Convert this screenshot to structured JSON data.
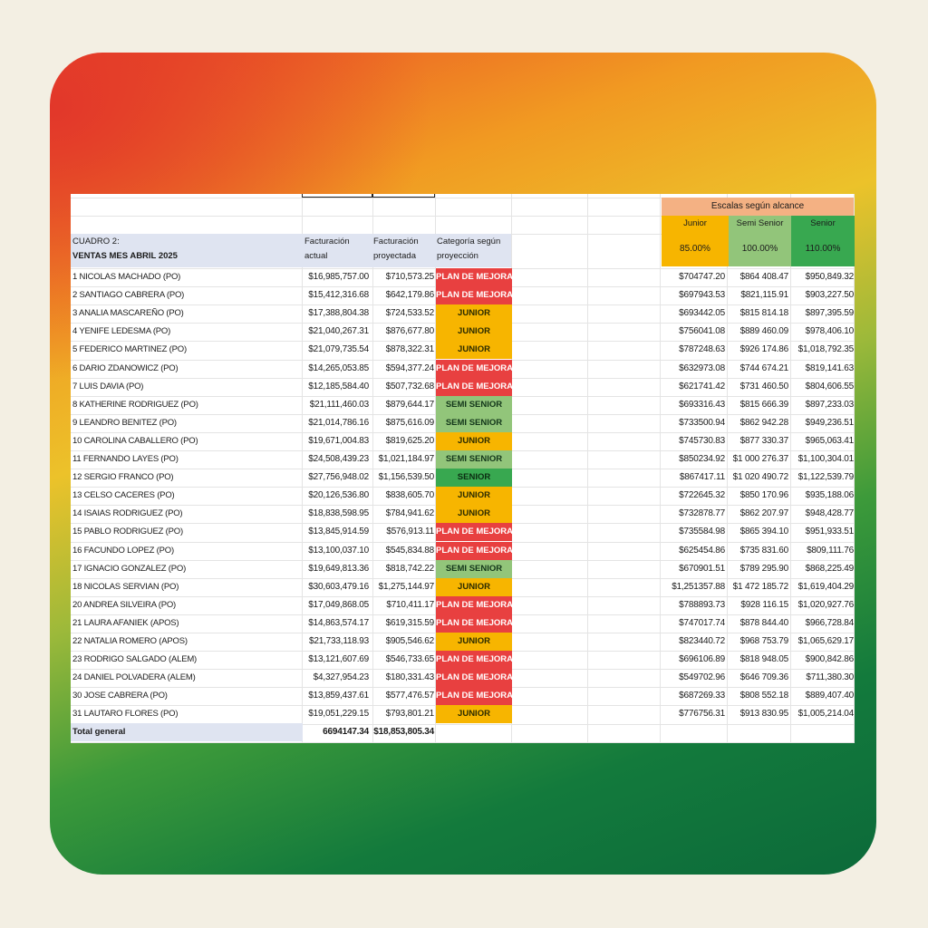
{
  "header": {
    "title_line1": "CUADRO 2:",
    "title_line2": "VENTAS MES ABRIL 2025",
    "col_actual_1": "Facturación",
    "col_actual_2": "actual",
    "col_proj_1": "Facturación",
    "col_proj_2": "proyectada",
    "col_cat_1": "Categoría según",
    "col_cat_2": "proyección"
  },
  "scales": {
    "title": "Escalas según alcance",
    "junior_label": "Junior",
    "semi_label": "Semi Senior",
    "senior_label": "Senior",
    "junior_pct": "85.00%",
    "semi_pct": "100.00%",
    "senior_pct": "110.00%"
  },
  "colors": {
    "plan": "#e84040",
    "junior": "#f7b500",
    "semi": "#92c57a",
    "senior": "#38a850",
    "scale_title_bg": "#f4b183"
  },
  "rows": [
    {
      "name": "1 NICOLAS MACHADO (PO)",
      "actual": "$16,985,757.00",
      "proj": "$710,573.25",
      "cat": "PLAN DE MEJORA",
      "type": "plan",
      "sj": "$704747.20",
      "ss": "$864 408.47",
      "sr": "$950,849.32"
    },
    {
      "name": "2 SANTIAGO CABRERA (PO)",
      "actual": "$15,412,316.68",
      "proj": "$642,179.86",
      "cat": "PLAN DE MEJORA",
      "type": "plan",
      "sj": "$697943.53",
      "ss": "$821,115.91",
      "sr": "$903,227.50"
    },
    {
      "name": "3 ANALIA MASCAREÑO (PO)",
      "actual": "$17,388,804.38",
      "proj": "$724,533.52",
      "cat": "JUNIOR",
      "type": "junior",
      "sj": "$693442.05",
      "ss": "$815 814.18",
      "sr": "$897,395.59"
    },
    {
      "name": "4 YENIFE LEDESMA (PO)",
      "actual": "$21,040,267.31",
      "proj": "$876,677.80",
      "cat": "JUNIOR",
      "type": "junior",
      "sj": "$756041.08",
      "ss": "$889 460.09",
      "sr": "$978,406.10"
    },
    {
      "name": "5 FEDERICO MARTINEZ (PO)",
      "actual": "$21,079,735.54",
      "proj": "$878,322.31",
      "cat": "JUNIOR",
      "type": "junior",
      "sj": "$787248.63",
      "ss": "$926 174.86",
      "sr": "$1,018,792.35"
    },
    {
      "name": "6 DARIO ZDANOWICZ (PO)",
      "actual": "$14,265,053.85",
      "proj": "$594,377.24",
      "cat": "PLAN DE MEJORA",
      "type": "plan",
      "sj": "$632973.08",
      "ss": "$744 674.21",
      "sr": "$819,141.63"
    },
    {
      "name": "7 LUIS DAVIA (PO)",
      "actual": "$12,185,584.40",
      "proj": "$507,732.68",
      "cat": "PLAN DE MEJORA",
      "type": "plan",
      "sj": "$621741.42",
      "ss": "$731 460.50",
      "sr": "$804,606.55"
    },
    {
      "name": "8 KATHERINE RODRIGUEZ (PO)",
      "actual": "$21,111,460.03",
      "proj": "$879,644.17",
      "cat": "SEMI SENIOR",
      "type": "semi",
      "sj": "$693316.43",
      "ss": "$815 666.39",
      "sr": "$897,233.03"
    },
    {
      "name": "9 LEANDRO BENITEZ (PO)",
      "actual": "$21,014,786.16",
      "proj": "$875,616.09",
      "cat": "SEMI SENIOR",
      "type": "semi",
      "sj": "$733500.94",
      "ss": "$862 942.28",
      "sr": "$949,236.51"
    },
    {
      "name": "10 CAROLINA CABALLERO (PO)",
      "actual": "$19,671,004.83",
      "proj": "$819,625.20",
      "cat": "JUNIOR",
      "type": "junior",
      "sj": "$745730.83",
      "ss": "$877 330.37",
      "sr": "$965,063.41"
    },
    {
      "name": "11 FERNANDO LAYES (PO)",
      "actual": "$24,508,439.23",
      "proj": "$1,021,184.97",
      "cat": "SEMI SENIOR",
      "type": "semi",
      "sj": "$850234.92",
      "ss": "$1 000 276.37",
      "sr": "$1,100,304.01"
    },
    {
      "name": "12 SERGIO FRANCO (PO)",
      "actual": "$27,756,948.02",
      "proj": "$1,156,539.50",
      "cat": "SENIOR",
      "type": "senior",
      "sj": "$867417.11",
      "ss": "$1 020 490.72",
      "sr": "$1,122,539.79"
    },
    {
      "name": "13 CELSO CACERES (PO)",
      "actual": "$20,126,536.80",
      "proj": "$838,605.70",
      "cat": "JUNIOR",
      "type": "junior",
      "sj": "$722645.32",
      "ss": "$850 170.96",
      "sr": "$935,188.06"
    },
    {
      "name": "14 ISAIAS RODRIGUEZ (PO)",
      "actual": "$18,838,598.95",
      "proj": "$784,941.62",
      "cat": "JUNIOR",
      "type": "junior",
      "sj": "$732878.77",
      "ss": "$862 207.97",
      "sr": "$948,428.77"
    },
    {
      "name": "15 PABLO RODRIGUEZ (PO)",
      "actual": "$13,845,914.59",
      "proj": "$576,913.11",
      "cat": "PLAN DE MEJORA",
      "type": "plan",
      "sj": "$735584.98",
      "ss": "$865 394.10",
      "sr": "$951,933.51"
    },
    {
      "name": "16 FACUNDO LOPEZ (PO)",
      "actual": "$13,100,037.10",
      "proj": "$545,834.88",
      "cat": "PLAN DE MEJORA",
      "type": "plan",
      "sj": "$625454.86",
      "ss": "$735 831.60",
      "sr": "$809,111.76"
    },
    {
      "name": "17 IGNACIO GONZALEZ (PO)",
      "actual": "$19,649,813.36",
      "proj": "$818,742.22",
      "cat": "SEMI SENIOR",
      "type": "semi",
      "sj": "$670901.51",
      "ss": "$789 295.90",
      "sr": "$868,225.49"
    },
    {
      "name": "18 NICOLAS SERVIAN (PO)",
      "actual": "$30,603,479.16",
      "proj": "$1,275,144.97",
      "cat": "JUNIOR",
      "type": "junior",
      "sj": "$1,251357.88",
      "ss": "$1 472 185.72",
      "sr": "$1,619,404.29"
    },
    {
      "name": "20 ANDREA SILVEIRA (PO)",
      "actual": "$17,049,868.05",
      "proj": "$710,411.17",
      "cat": "PLAN DE MEJORA",
      "type": "plan",
      "sj": "$788893.73",
      "ss": "$928 116.15",
      "sr": "$1,020,927.76"
    },
    {
      "name": "21 LAURA AFANIEK (APOS)",
      "actual": "$14,863,574.17",
      "proj": "$619,315.59",
      "cat": "PLAN DE MEJORA",
      "type": "plan",
      "sj": "$747017.74",
      "ss": "$878 844.40",
      "sr": "$966,728.84"
    },
    {
      "name": "22 NATALIA ROMERO (APOS)",
      "actual": "$21,733,118.93",
      "proj": "$905,546.62",
      "cat": "JUNIOR",
      "type": "junior",
      "sj": "$823440.72",
      "ss": "$968 753.79",
      "sr": "$1,065,629.17"
    },
    {
      "name": "23 RODRIGO SALGADO (ALEM)",
      "actual": "$13,121,607.69",
      "proj": "$546,733.65",
      "cat": "PLAN DE MEJORA",
      "type": "plan",
      "sj": "$696106.89",
      "ss": "$818 948.05",
      "sr": "$900,842.86"
    },
    {
      "name": "24 DANIEL POLVADERA (ALEM)",
      "actual": "$4,327,954.23",
      "proj": "$180,331.43",
      "cat": "PLAN DE MEJORA",
      "type": "plan",
      "sj": "$549702.96",
      "ss": "$646 709.36",
      "sr": "$711,380.30"
    },
    {
      "name": "30 JOSE CABRERA (PO)",
      "actual": "$13,859,437.61",
      "proj": "$577,476.57",
      "cat": "PLAN DE MEJORA",
      "type": "plan",
      "sj": "$687269.33",
      "ss": "$808 552.18",
      "sr": "$889,407.40"
    },
    {
      "name": "31 LAUTARO FLORES (PO)",
      "actual": "$19,051,229.15",
      "proj": "$793,801.21",
      "cat": "JUNIOR",
      "type": "junior",
      "sj": "$776756.31",
      "ss": "$913 830.95",
      "sr": "$1,005,214.04"
    }
  ],
  "total": {
    "label": "Total general",
    "actual": "6694147.34",
    "proj": "$18,853,805.34"
  }
}
